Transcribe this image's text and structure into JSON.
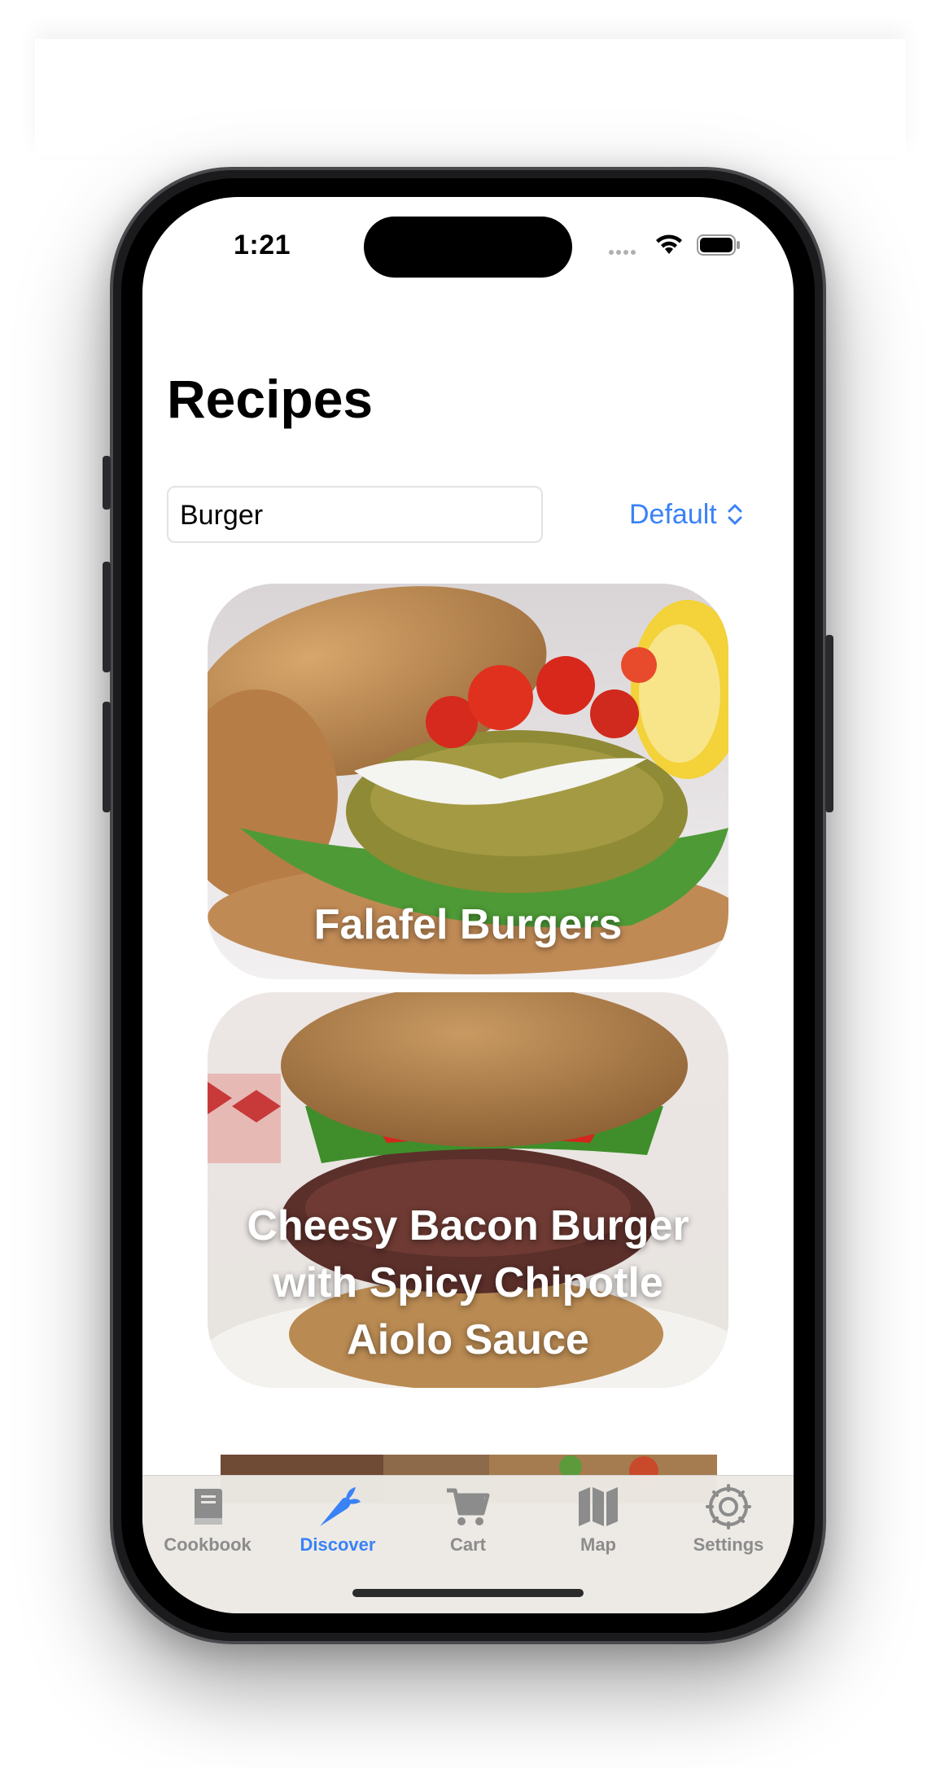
{
  "status_bar": {
    "time": "1:21"
  },
  "header": {
    "title": "Recipes"
  },
  "search": {
    "value": "Burger"
  },
  "sort": {
    "label": "Default"
  },
  "recipes": [
    {
      "title": "Falafel Burgers"
    },
    {
      "title": "Cheesy Bacon Burger with Spicy Chipotle Aiolo Sauce"
    }
  ],
  "tabbar": {
    "items": [
      {
        "label": "Cookbook",
        "icon": "book-icon",
        "active": false
      },
      {
        "label": "Discover",
        "icon": "carrot-icon",
        "active": true
      },
      {
        "label": "Cart",
        "icon": "cart-icon",
        "active": false
      },
      {
        "label": "Map",
        "icon": "map-icon",
        "active": false
      },
      {
        "label": "Settings",
        "icon": "gear-icon",
        "active": false
      }
    ]
  },
  "colors": {
    "accent": "#3a82f6",
    "inactive": "#8c8c8c"
  }
}
